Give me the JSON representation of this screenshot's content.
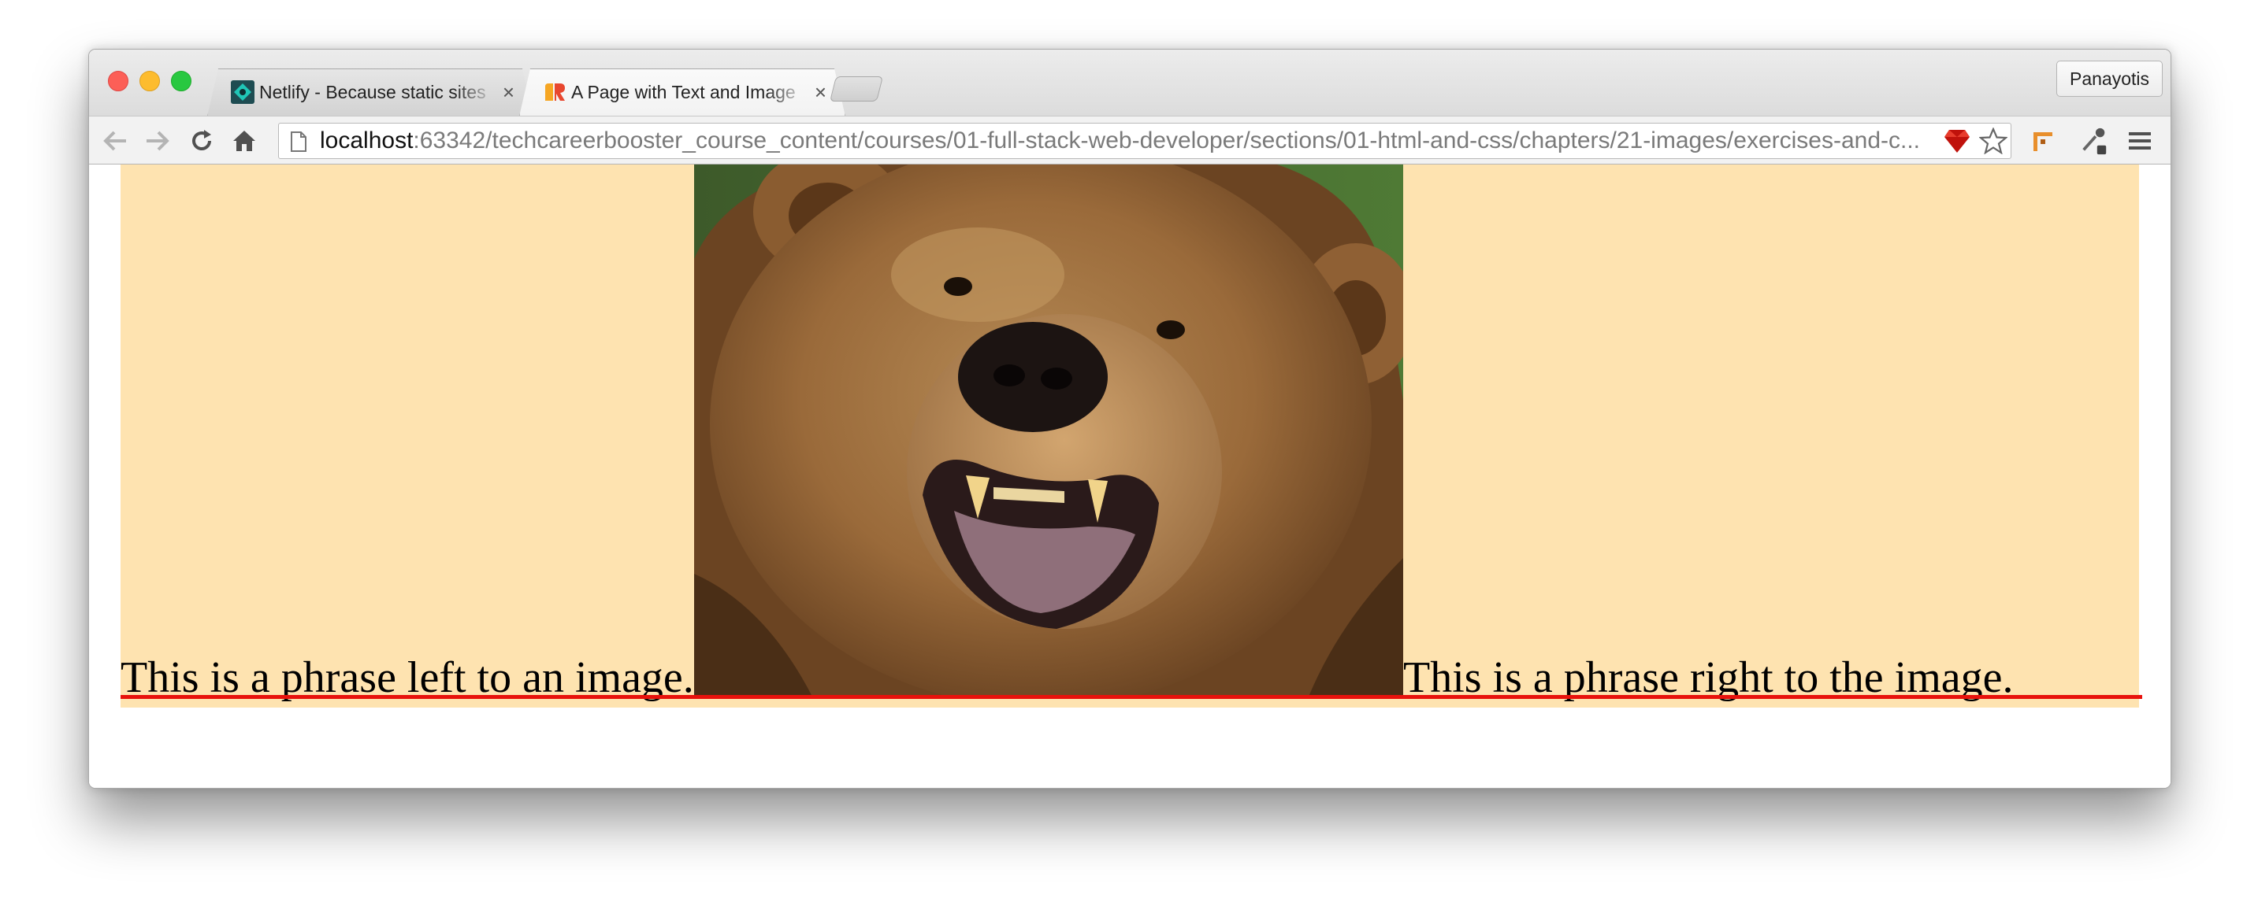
{
  "browser": {
    "tabs": [
      {
        "title": "Netlify - Because static sites",
        "close": "×",
        "active": false,
        "favicon": "netlify-icon"
      },
      {
        "title": "A Page with Text and Image",
        "close": "×",
        "active": true,
        "favicon": "rubymine-icon"
      }
    ],
    "profile_name": "Panayotis",
    "url_host": "localhost",
    "url_rest": ":63342/techcareerbooster_course_content/courses/01-full-stack-web-developer/sections/01-html-and-css/chapters/21-images/exercises-and-c...",
    "icons": [
      "back-arrow-icon",
      "forward-arrow-icon",
      "reload-icon",
      "home-icon",
      "page-icon",
      "ruby-icon",
      "star-icon",
      "extension-icon",
      "eyedropper-icon",
      "menu-icon"
    ]
  },
  "page": {
    "left_phrase": "This is a phrase left to an image.",
    "right_phrase": "This is a phrase right to the image.",
    "image_subject": "grizzly bear",
    "background_color": "#fee3b0",
    "baseline_color": "#e8120c"
  }
}
